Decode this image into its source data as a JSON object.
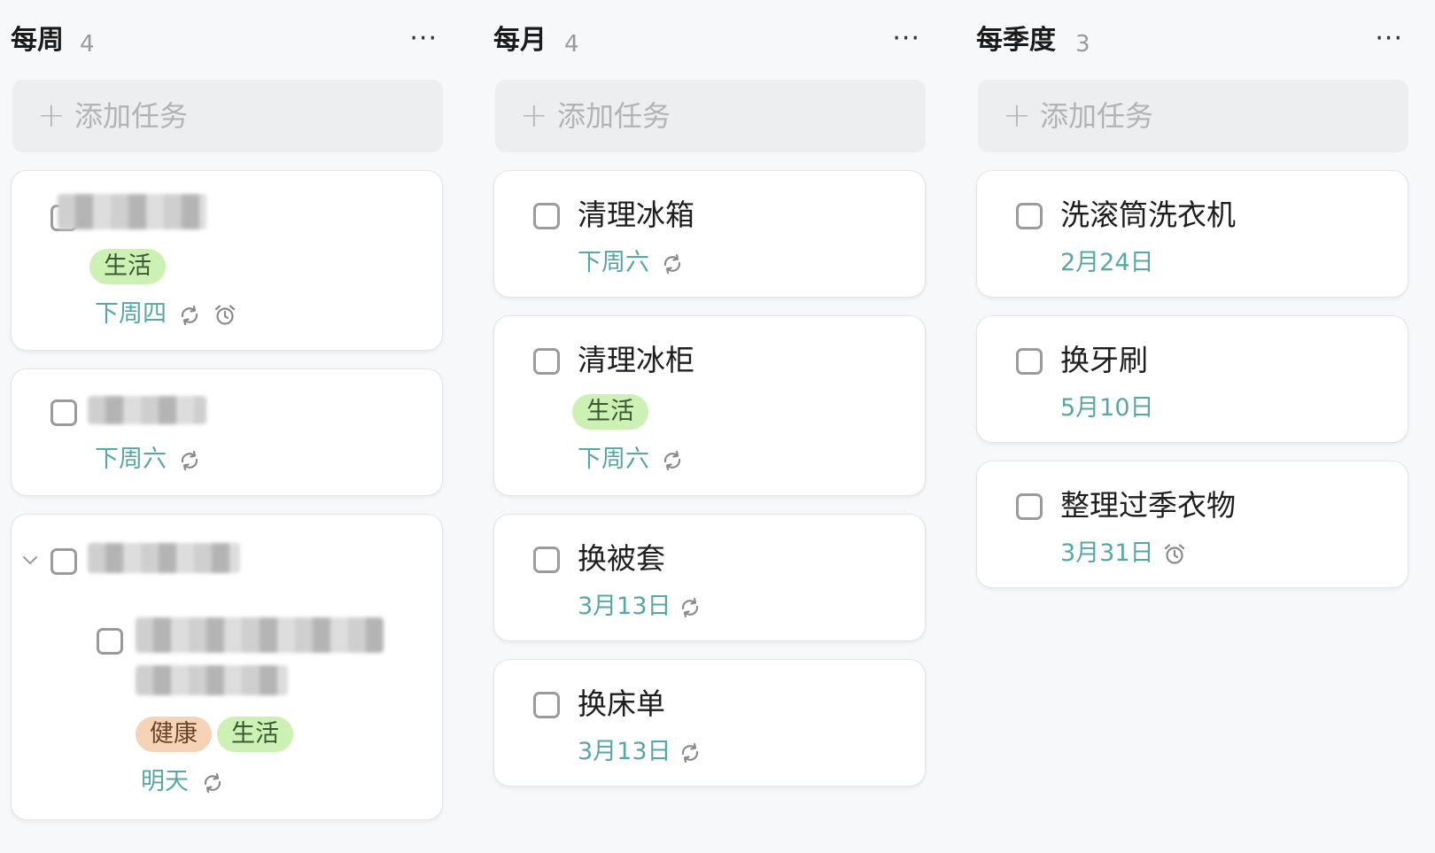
{
  "add_task_label": "添加任务",
  "columns": [
    {
      "title": "每周",
      "count": "4",
      "more": "···",
      "tasks": [
        {
          "tag": "生活",
          "due": "下周四"
        },
        {
          "due": "下周六"
        },
        {
          "subtask": {
            "tags": [
              "健康",
              "生活"
            ],
            "due": "明天"
          }
        }
      ]
    },
    {
      "title": "每月",
      "count": "4",
      "more": "···",
      "tasks": [
        {
          "title": "清理冰箱",
          "due": "下周六"
        },
        {
          "title": "清理冰柜",
          "tag": "生活",
          "due": "下周六"
        },
        {
          "title": "换被套",
          "due": "3月13日"
        },
        {
          "title": "换床单",
          "due": "3月13日"
        }
      ]
    },
    {
      "title": "每季度",
      "count": "3",
      "more": "···",
      "tasks": [
        {
          "title": "洗滚筒洗衣机",
          "due": "2月24日"
        },
        {
          "title": "换牙刷",
          "due": "5月10日"
        },
        {
          "title": "整理过季衣物",
          "due": "3月31日"
        }
      ]
    }
  ],
  "colors": {
    "due": "#56a7a5",
    "tag_green": "#cdf0b4",
    "tag_orange": "#f6d2b6"
  }
}
